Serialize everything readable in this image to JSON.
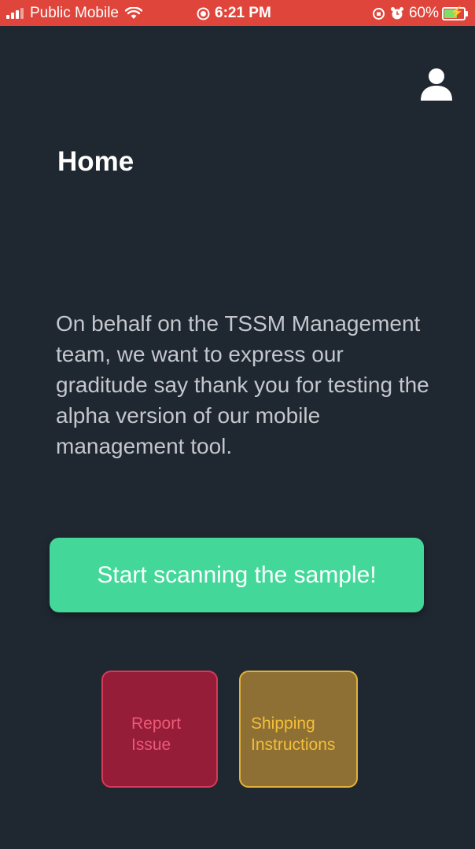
{
  "status_bar": {
    "carrier": "Public Mobile",
    "time": "6:21 PM",
    "battery_percent": "60%",
    "battery_level": 0.6,
    "bg_color": "#e0453b"
  },
  "header": {
    "profile_icon": "user-icon"
  },
  "main": {
    "title": "Home",
    "message": "On behalf on the TSSM Management team, we want to express our graditude say thank you for testing the alpha version of our mobile management tool.",
    "scan_button_label": "Start scanning the sample!",
    "scan_button_color": "#43d89a"
  },
  "tiles": {
    "report": {
      "line1": "Report",
      "line2": "Issue",
      "color": "#951d38"
    },
    "shipping": {
      "line1": "Shipping",
      "line2": "Instructions",
      "color": "#8e7034"
    }
  },
  "theme": {
    "background": "#1f2731"
  }
}
